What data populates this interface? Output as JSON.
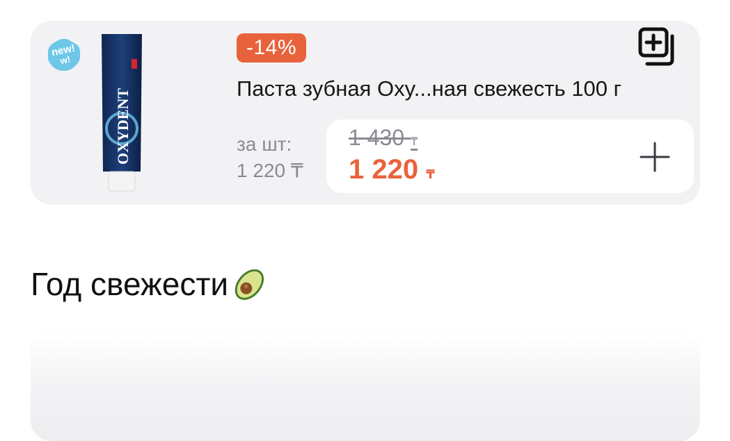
{
  "product": {
    "badge_new": "new!",
    "discount": "-14%",
    "title": "Паста зубная Oxy...ная свежесть 100 г",
    "brand": "OXYDENT",
    "unit_label": "за шт:",
    "unit_price": "1 220 ₸",
    "old_price": "1 430",
    "new_price": "1 220",
    "currency": "₸",
    "colors": {
      "accent": "#e8633c",
      "card_bg": "#f2f2f5",
      "muted": "#8a8a95"
    }
  },
  "section": {
    "title": "Год свежести"
  },
  "icons": {
    "badge": "new-sticker-icon",
    "favorite": "add-to-list-icon",
    "add": "plus-icon",
    "emoji": "avocado-icon"
  }
}
